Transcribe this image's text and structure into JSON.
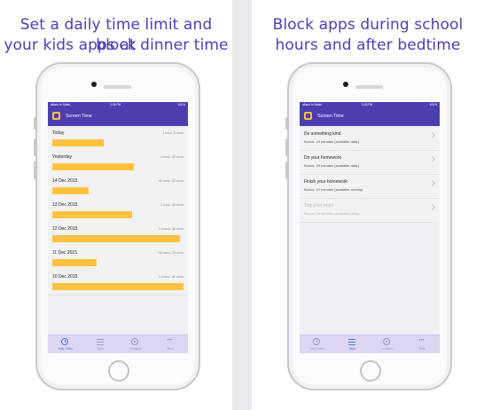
{
  "left": {
    "caption": [
      "Set a daily time limit and block",
      "your kids apps at dinner time"
    ],
    "status": {
      "left": "◂Back to Safari",
      "time": "3:26 PM",
      "right": "100%"
    },
    "nav_title": "Screen Time",
    "usage_rows": [
      {
        "label": "Today",
        "value": "1 hour, 5 mins",
        "fraction": 0.39
      },
      {
        "label": "Yesterday",
        "value": "1 hour, 42 mins",
        "fraction": 0.62
      },
      {
        "label": "14 Dec 2015",
        "value": "46 mins, 22 secs",
        "fraction": 0.28
      },
      {
        "label": "13 Dec 2015",
        "value": "1 hour, 40 mins",
        "fraction": 0.61
      },
      {
        "label": "12 Dec 2015",
        "value": "2 hours, 38 mins",
        "fraction": 0.97
      },
      {
        "label": "11 Dec 2015",
        "value": "56 mins, 25 secs",
        "fraction": 0.34
      },
      {
        "label": "10 Dec 2015",
        "value": "2 hours, 46 mins",
        "fraction": 1.0
      }
    ],
    "tabs": [
      {
        "label": "Daily Totals",
        "icon": "clock-icon",
        "active": true
      },
      {
        "label": "Tasks",
        "icon": "list-icon",
        "active": false
      },
      {
        "label": "Locations",
        "icon": "compass-icon",
        "active": false
      },
      {
        "label": "More",
        "icon": "more-icon",
        "active": false
      }
    ]
  },
  "right": {
    "caption": [
      "Block apps during school",
      "hours and after bedtime"
    ],
    "status": {
      "left": "◂Back to Safari",
      "time": "3:26 PM",
      "right": "100%"
    },
    "nav_title": "Screen Time",
    "tasks": [
      {
        "title": "Do something kind",
        "bonus": "Bonus: 15 minutes (available daily)",
        "dim": false
      },
      {
        "title": "Do your homework",
        "bonus": "Bonus: 20 minutes (available daily)",
        "dim": false
      },
      {
        "title": "Finish your homework",
        "bonus": "Bonus: 10 minutes (available weekly)",
        "dim": false
      },
      {
        "title": "Tidy your room",
        "bonus": "Bonus: 10 minutes (available daily)",
        "dim": true
      }
    ],
    "tabs": [
      {
        "label": "Daily Totals",
        "icon": "clock-icon",
        "active": false
      },
      {
        "label": "Tasks",
        "icon": "list-icon",
        "active": true
      },
      {
        "label": "Locations",
        "icon": "compass-icon",
        "active": false
      },
      {
        "label": "More",
        "icon": "more-icon",
        "active": false
      }
    ]
  },
  "colors": {
    "brand": "#4b3fb0",
    "bar": "#ffc23f",
    "caption": "#4a40b8"
  }
}
